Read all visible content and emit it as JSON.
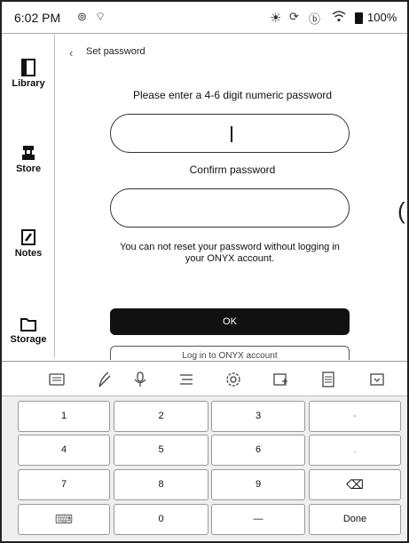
{
  "status_bar": {
    "time": "6:02 PM",
    "battery": "100%",
    "icons": [
      "notification-icon",
      "wifi-small-icon",
      "brightness-icon",
      "sync-icon",
      "bluetooth-icon",
      "wifi-icon",
      "battery-icon"
    ]
  },
  "sidebar": {
    "items": [
      {
        "label": "Library",
        "icon": "library-icon"
      },
      {
        "label": "Store",
        "icon": "store-icon"
      },
      {
        "label": "Notes",
        "icon": "notes-icon"
      },
      {
        "label": "Storage",
        "icon": "storage-icon"
      }
    ]
  },
  "page": {
    "breadcrumb": "Set password",
    "prompt": "Please enter a 4-6 digit numeric password",
    "confirm_label": "Confirm password",
    "warning": "You can not reset your password without logging in your ONYX account.",
    "ok_label": "OK",
    "login_label": "Log in to ONYX account"
  },
  "keyboard_toolbar": {
    "icons": [
      "keyboard-icon",
      "handwriting-icon",
      "microphone-icon",
      "clipboard-icon",
      "settings-icon",
      "add-icon",
      "document-icon",
      "hide-keyboard-icon"
    ]
  },
  "keypad": {
    "rows": [
      [
        "1",
        "2",
        "3",
        "-"
      ],
      [
        "4",
        "5",
        "6",
        "."
      ],
      [
        "7",
        "8",
        "9",
        "⌫"
      ],
      [
        "⌨",
        "0",
        "—",
        "Done"
      ]
    ]
  }
}
